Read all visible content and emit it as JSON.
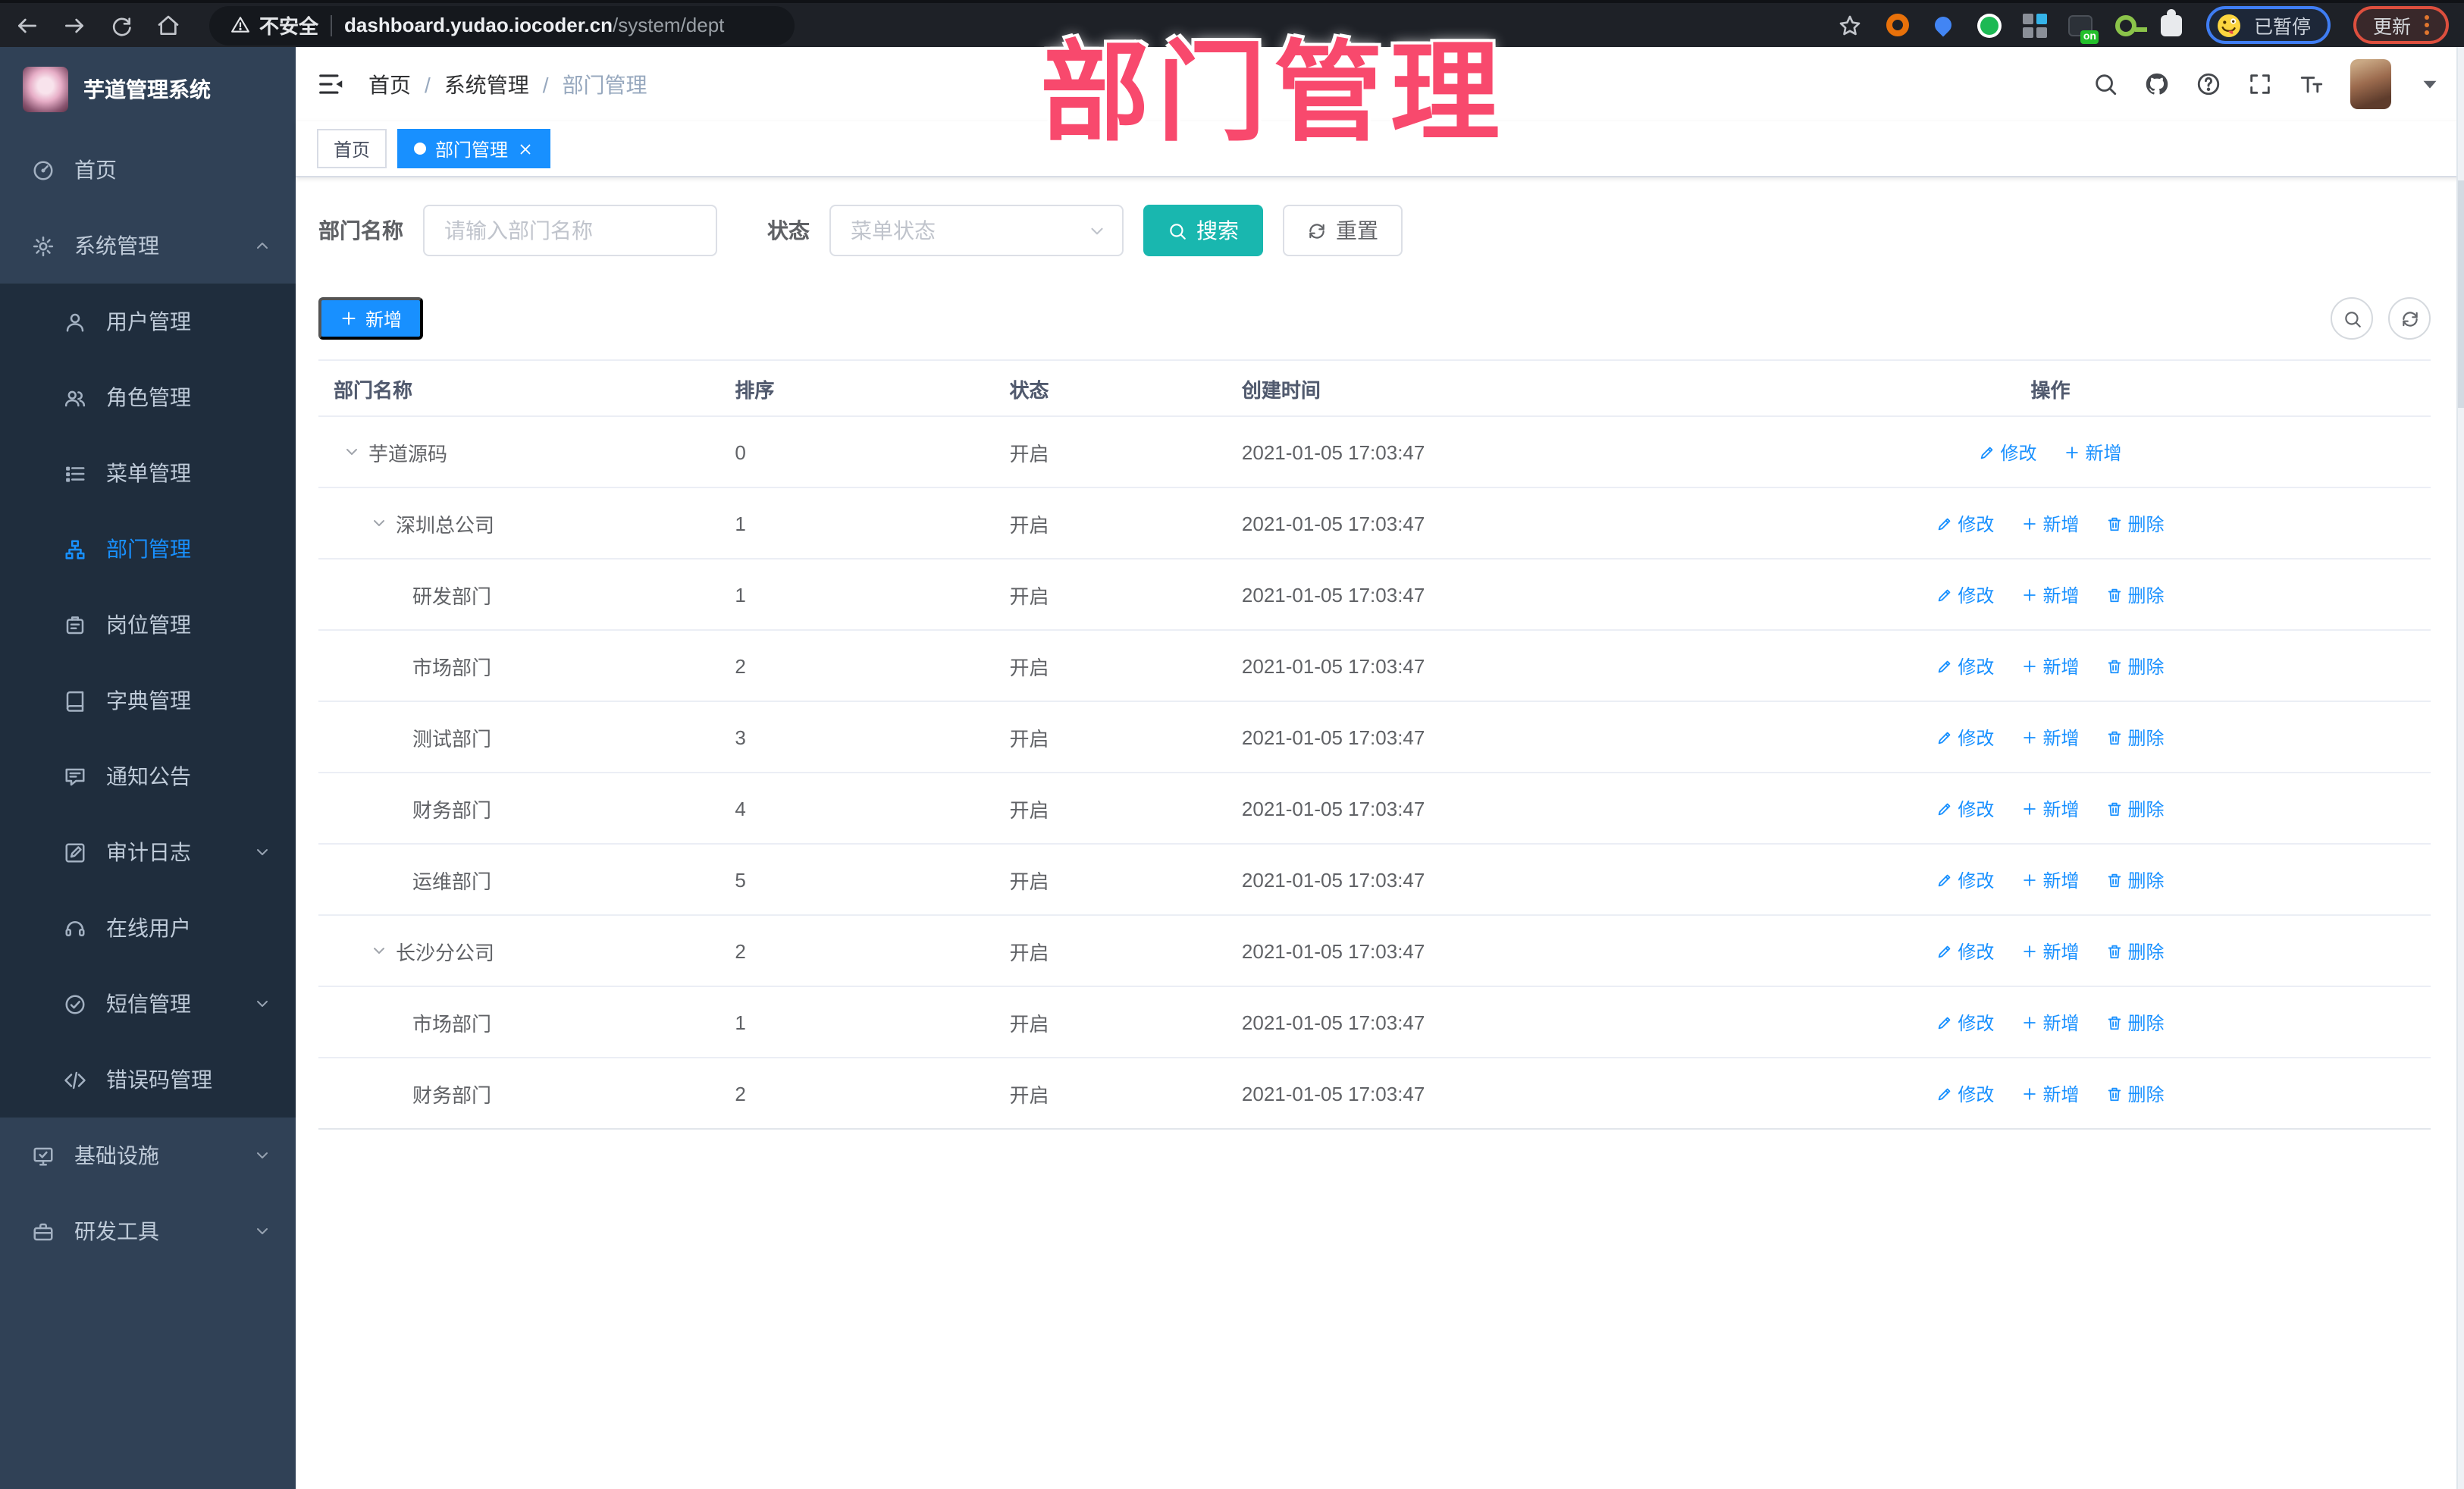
{
  "browser": {
    "security_label": "不安全",
    "url_domain": "dashboard.yudao.iocoder.cn",
    "url_path": "/system/dept",
    "extension_badge": "on",
    "profile_chip_label": "已暂停",
    "update_button_label": "更新"
  },
  "sidebar": {
    "app_title": "芋道管理系统",
    "menu": [
      {
        "kind": "item",
        "key": "home",
        "icon": "i-gauge",
        "icon_name": "dashboard-icon",
        "label": "首页"
      },
      {
        "kind": "item",
        "key": "system",
        "icon": "i-gear",
        "icon_name": "gear-icon",
        "label": "系统管理",
        "chevron": "up"
      },
      {
        "kind": "group",
        "items": [
          {
            "key": "users",
            "icon": "i-user",
            "icon_name": "user-icon",
            "label": "用户管理"
          },
          {
            "key": "roles",
            "icon": "i-users",
            "icon_name": "users-icon",
            "label": "角色管理"
          },
          {
            "key": "menus",
            "icon": "i-list",
            "icon_name": "list-icon",
            "label": "菜单管理"
          },
          {
            "key": "depts",
            "icon": "i-tree",
            "icon_name": "org-tree-icon",
            "label": "部门管理",
            "active": true
          },
          {
            "key": "posts",
            "icon": "i-badge",
            "icon_name": "briefcase-icon",
            "label": "岗位管理"
          },
          {
            "key": "dicts",
            "icon": "i-book",
            "icon_name": "book-icon",
            "label": "字典管理"
          },
          {
            "key": "notices",
            "icon": "i-bubble",
            "icon_name": "speech-bubble-icon",
            "label": "通知公告"
          },
          {
            "key": "audit-log",
            "icon": "i-log",
            "icon_name": "edit-document-icon",
            "label": "审计日志",
            "chevron": "down"
          },
          {
            "key": "online-users",
            "icon": "i-headset",
            "icon_name": "headset-icon",
            "label": "在线用户"
          },
          {
            "key": "sms",
            "icon": "i-circlecheck",
            "icon_name": "circle-check-icon",
            "label": "短信管理",
            "chevron": "down"
          },
          {
            "key": "error-codes",
            "icon": "i-code",
            "icon_name": "code-icon",
            "label": "错误码管理"
          }
        ]
      },
      {
        "kind": "item",
        "key": "infra",
        "icon": "i-monitor",
        "icon_name": "monitor-icon",
        "label": "基础设施",
        "chevron": "down"
      },
      {
        "kind": "item",
        "key": "dev-tools",
        "icon": "i-toolbox",
        "icon_name": "toolbox-icon",
        "label": "研发工具",
        "chevron": "down"
      }
    ]
  },
  "header": {
    "breadcrumb": [
      "首页",
      "系统管理",
      "部门管理"
    ],
    "breadcrumb_separator": "/"
  },
  "tabs": [
    {
      "label": "首页",
      "active": false
    },
    {
      "label": "部门管理",
      "active": true
    }
  ],
  "watermark": "部门管理",
  "filter": {
    "name_label": "部门名称",
    "name_placeholder": "请输入部门名称",
    "status_label": "状态",
    "status_placeholder": "菜单状态",
    "search_label": "搜索",
    "reset_label": "重置"
  },
  "toolbar": {
    "add_label": "新增"
  },
  "table": {
    "columns": [
      "部门名称",
      "排序",
      "状态",
      "创建时间",
      "操作"
    ],
    "action_labels": {
      "edit": "修改",
      "add": "新增",
      "delete": "删除"
    },
    "rows": [
      {
        "name": "芋道源码",
        "level": 0,
        "expanded": true,
        "sort": "0",
        "status": "开启",
        "created": "2021-01-05 17:03:47",
        "actions": [
          "edit",
          "add"
        ]
      },
      {
        "name": "深圳总公司",
        "level": 1,
        "expanded": true,
        "sort": "1",
        "status": "开启",
        "created": "2021-01-05 17:03:47",
        "actions": [
          "edit",
          "add",
          "delete"
        ]
      },
      {
        "name": "研发部门",
        "level": 2,
        "sort": "1",
        "status": "开启",
        "created": "2021-01-05 17:03:47",
        "actions": [
          "edit",
          "add",
          "delete"
        ]
      },
      {
        "name": "市场部门",
        "level": 2,
        "sort": "2",
        "status": "开启",
        "created": "2021-01-05 17:03:47",
        "actions": [
          "edit",
          "add",
          "delete"
        ]
      },
      {
        "name": "测试部门",
        "level": 2,
        "sort": "3",
        "status": "开启",
        "created": "2021-01-05 17:03:47",
        "actions": [
          "edit",
          "add",
          "delete"
        ]
      },
      {
        "name": "财务部门",
        "level": 2,
        "sort": "4",
        "status": "开启",
        "created": "2021-01-05 17:03:47",
        "actions": [
          "edit",
          "add",
          "delete"
        ]
      },
      {
        "name": "运维部门",
        "level": 2,
        "sort": "5",
        "status": "开启",
        "created": "2021-01-05 17:03:47",
        "actions": [
          "edit",
          "add",
          "delete"
        ]
      },
      {
        "name": "长沙分公司",
        "level": 1,
        "expanded": true,
        "sort": "2",
        "status": "开启",
        "created": "2021-01-05 17:03:47",
        "actions": [
          "edit",
          "add",
          "delete"
        ]
      },
      {
        "name": "市场部门",
        "level": 2,
        "sort": "1",
        "status": "开启",
        "created": "2021-01-05 17:03:47",
        "actions": [
          "edit",
          "add",
          "delete"
        ]
      },
      {
        "name": "财务部门",
        "level": 2,
        "sort": "2",
        "status": "开启",
        "created": "2021-01-05 17:03:47",
        "actions": [
          "edit",
          "add",
          "delete"
        ]
      }
    ]
  },
  "colors": {
    "primary": "#1890ff",
    "search_teal": "#19b7af",
    "pink_annotation": "#f8496d",
    "sidebar_bg": "#304156",
    "submenu_bg": "#1f2d3d"
  }
}
